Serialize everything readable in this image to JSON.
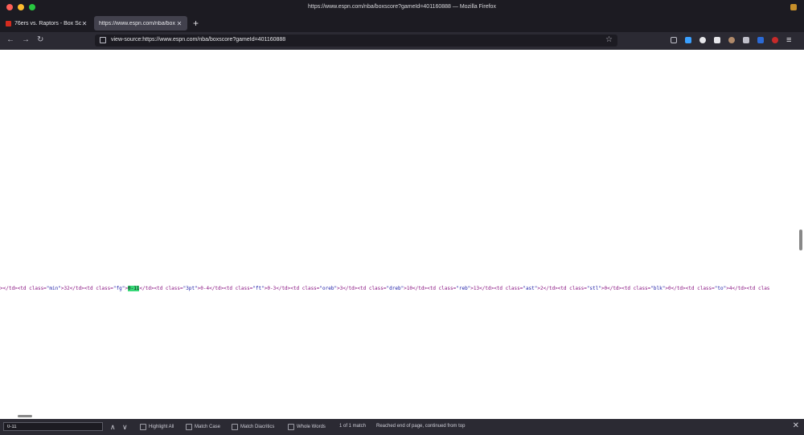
{
  "window": {
    "title": "https://www.espn.com/nba/boxscore?gameId=401160888 — Mozilla Firefox",
    "traffic_colors": [
      "#fe5f57",
      "#febc2e",
      "#28c840"
    ]
  },
  "tabs": [
    {
      "label": "76ers vs. Raptors - Box Sco",
      "active": false
    },
    {
      "label": "https://www.espn.com/nba/box",
      "active": true
    }
  ],
  "tab_close_glyph": "✕",
  "new_tab_glyph": "+",
  "navbar": {
    "back_glyph": "←",
    "forward_glyph": "→",
    "reload_glyph": "↻",
    "url": "view-source:https://www.espn.com/nba/boxscore?gameId=401160888",
    "bookmark_glyph": "☆",
    "menu_glyph": "≡",
    "toolbar_icons": [
      "pocket-icon",
      "download-icon",
      "extension-icon",
      "crop-icon",
      "avatar-icon",
      "vpn-icon",
      "extension-icon",
      "ublock-icon"
    ]
  },
  "source_line": [
    {
      "text": "></td><td class=",
      "k": "tagc"
    },
    {
      "text": "\"min\"",
      "k": "val"
    },
    {
      "text": ">32</td><td class=",
      "k": "tagc"
    },
    {
      "text": "\"fg\"",
      "k": "val"
    },
    {
      "text": ">",
      "k": "tagc"
    },
    {
      "text": "0-11",
      "k": "hl"
    },
    {
      "text": "</td><td class=",
      "k": "tagc"
    },
    {
      "text": "\"3pt\"",
      "k": "val"
    },
    {
      "text": ">0-4</td><td class=",
      "k": "tagc"
    },
    {
      "text": "\"ft\"",
      "k": "val"
    },
    {
      "text": ">0-3</td><td class=",
      "k": "tagc"
    },
    {
      "text": "\"oreb\"",
      "k": "val"
    },
    {
      "text": ">3</td><td class=",
      "k": "tagc"
    },
    {
      "text": "\"dreb\"",
      "k": "val"
    },
    {
      "text": ">10</td><td class=",
      "k": "tagc"
    },
    {
      "text": "\"reb\"",
      "k": "val"
    },
    {
      "text": ">13</td><td class=",
      "k": "tagc"
    },
    {
      "text": "\"ast\"",
      "k": "val"
    },
    {
      "text": ">2</td><td class=",
      "k": "tagc"
    },
    {
      "text": "\"stl\"",
      "k": "val"
    },
    {
      "text": ">0</td><td class=",
      "k": "tagc"
    },
    {
      "text": "\"blk\"",
      "k": "val"
    },
    {
      "text": ">0</td><td class=",
      "k": "tagc"
    },
    {
      "text": "\"to\"",
      "k": "val"
    },
    {
      "text": ">4</td><td clas",
      "k": "tagc"
    }
  ],
  "findbar": {
    "query": "0-11",
    "prev_glyph": "∧",
    "next_glyph": "∨",
    "options": [
      "Highlight All",
      "Match Case",
      "Match Diacritics",
      "Whole Words"
    ],
    "match_count": "1 of 1 match",
    "status": "Reached end of page, continued from top",
    "close_glyph": "✕"
  }
}
